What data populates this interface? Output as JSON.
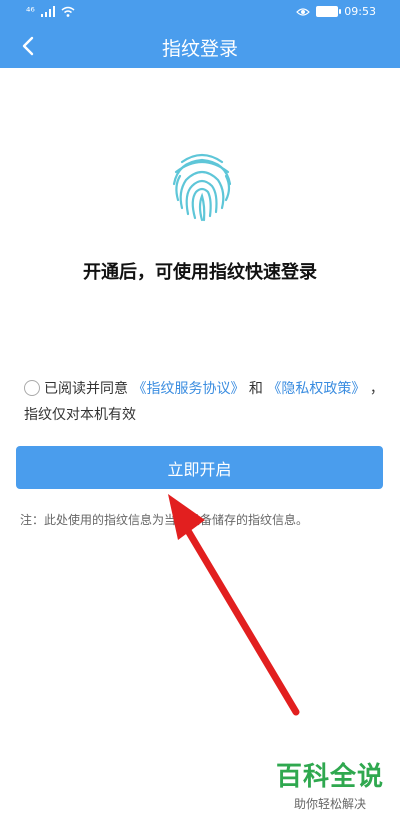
{
  "status_bar": {
    "left_indicator": "⁴⁶",
    "time": "09:53"
  },
  "header": {
    "back_icon": "chevron-left-icon",
    "title": "指纹登录"
  },
  "main": {
    "fingerprint_icon": "fingerprint-icon",
    "headline": "开通后，可使用指纹快速登录",
    "agreement": {
      "prefix": "已阅读并同意",
      "link_service": "《指纹服务协议》",
      "and": "和",
      "link_privacy": "《隐私权政策》",
      "suffix": "，指纹仅对本机有效"
    },
    "button_label": "立即开启",
    "note": "注：此处使用的指纹信息为当前设备储存的指纹信息。"
  },
  "watermark": {
    "brand": "百科全说",
    "tagline": "助你轻松解决"
  },
  "colors": {
    "primary": "#4a9ded",
    "link": "#3b8de0",
    "arrow": "#e21f1f"
  }
}
